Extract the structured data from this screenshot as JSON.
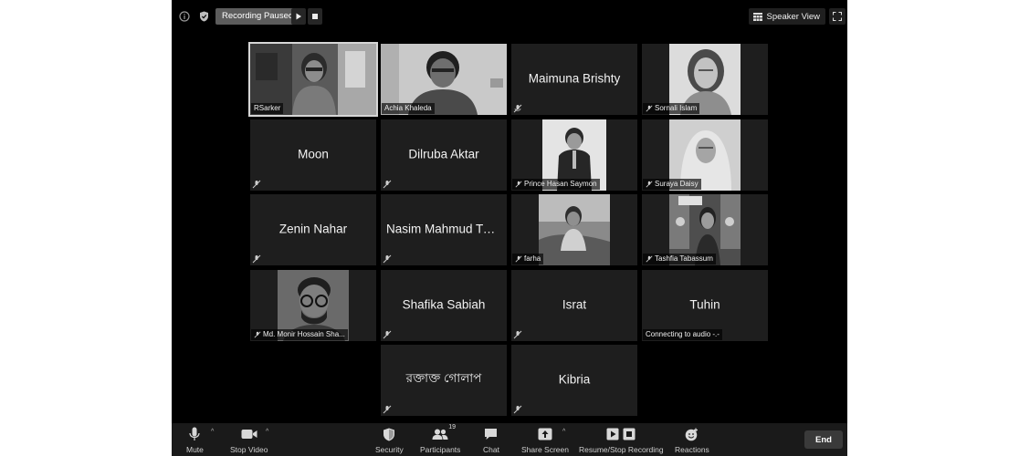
{
  "topbar": {
    "recording_label": "Recording Paused",
    "view_label": "Speaker View"
  },
  "participants": [
    {
      "name": "RSarker",
      "display": "label"
    },
    {
      "name": "Achia Khaleda",
      "display": "label"
    },
    {
      "name": "Maimuna Brishty",
      "display": "center"
    },
    {
      "name": "Sornali Islam",
      "display": "label"
    },
    {
      "name": "Moon",
      "display": "center"
    },
    {
      "name": "Dilruba Aktar",
      "display": "center"
    },
    {
      "name": "Prince Hasan Saymon",
      "display": "label"
    },
    {
      "name": "Suraya Daisy",
      "display": "label"
    },
    {
      "name": "Zenin Nahar",
      "display": "center"
    },
    {
      "name": "Nasim Mahmud Tus...",
      "display": "center"
    },
    {
      "name": "farha",
      "display": "label"
    },
    {
      "name": "Tashfia Tabassum",
      "display": "label"
    },
    {
      "name": "Md. Monir Hossain Sha...",
      "display": "label"
    },
    {
      "name": "Shafika Sabiah",
      "display": "center"
    },
    {
      "name": "Israt",
      "display": "center"
    },
    {
      "name": "Tuhin",
      "display": "center"
    },
    {
      "name": "রক্তাক্ত গোলাপ",
      "display": "center"
    },
    {
      "name": "Kibria",
      "display": "center"
    }
  ],
  "connecting_label": "Connecting to audio -.-",
  "toolbar": {
    "mute": "Mute",
    "stop_video": "Stop Video",
    "security": "Security",
    "participants": "Participants",
    "participants_count": "19",
    "chat": "Chat",
    "share_screen": "Share Screen",
    "resume_stop_recording": "Resume/Stop Recording",
    "reactions": "Reactions",
    "end": "End"
  }
}
